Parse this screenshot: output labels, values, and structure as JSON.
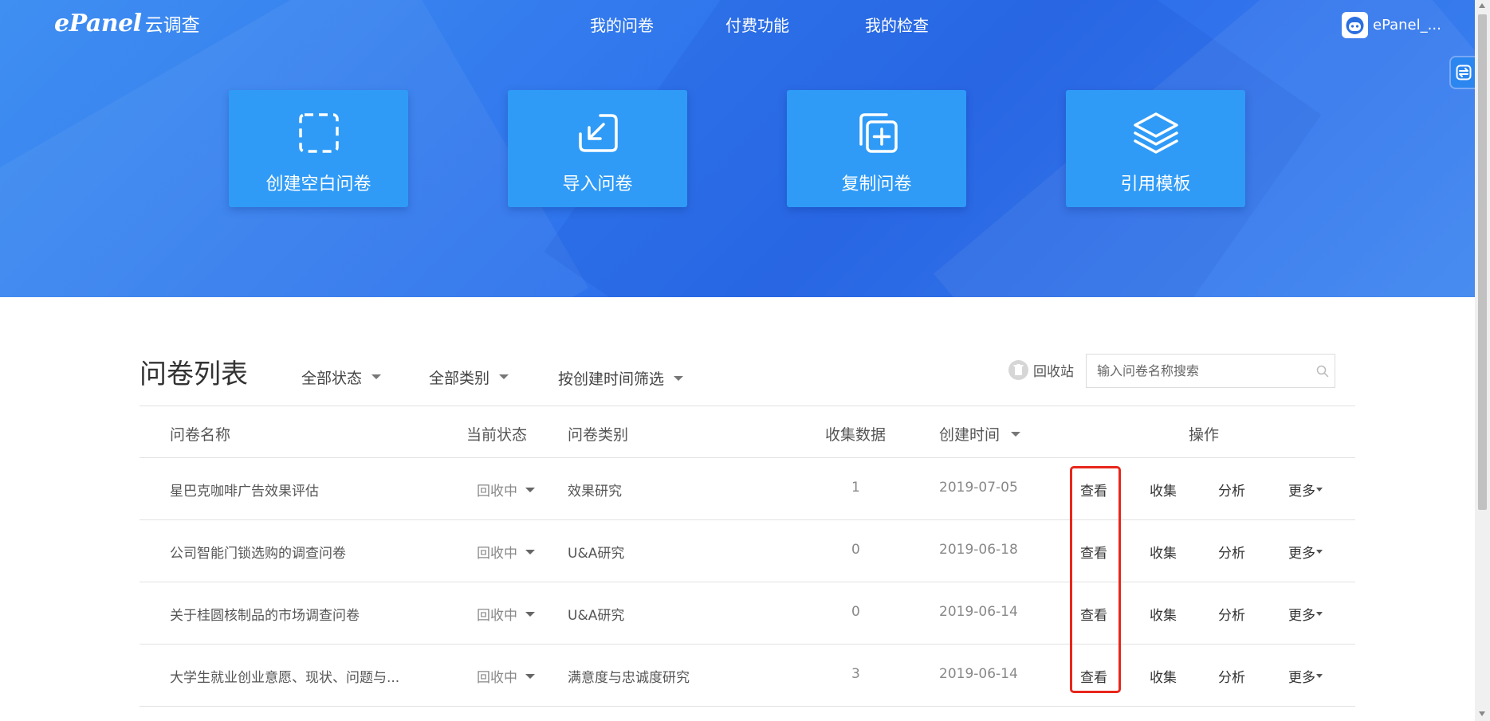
{
  "header": {
    "brand": "ePanel",
    "brand_cn": "云调查",
    "nav": [
      "我的问卷",
      "付费功能",
      "我的检查"
    ],
    "user_name": "ePanel_..."
  },
  "cards": [
    {
      "label": "创建空白问卷",
      "icon": "dashed-square-icon"
    },
    {
      "label": "导入问卷",
      "icon": "import-arrow-icon"
    },
    {
      "label": "复制问卷",
      "icon": "copy-plus-icon"
    },
    {
      "label": "引用模板",
      "icon": "layers-icon"
    }
  ],
  "list": {
    "title": "问卷列表",
    "filters": [
      "全部状态",
      "全部类别",
      "按创建时间筛选"
    ],
    "recycle_label": "回收站",
    "search_placeholder": "输入问卷名称搜索",
    "columns": {
      "name": "问卷名称",
      "status": "当前状态",
      "type": "问卷类别",
      "count": "收集数据",
      "date": "创建时间",
      "actions": "操作"
    },
    "action_labels": {
      "view": "查看",
      "collect": "收集",
      "analyze": "分析",
      "more": "更多"
    },
    "rows": [
      {
        "name": "星巴克咖啡广告效果评估",
        "status": "回收中",
        "type": "效果研究",
        "count": "1",
        "date": "2019-07-05"
      },
      {
        "name": "公司智能门锁选购的调查问卷",
        "status": "回收中",
        "type": "U&A研究",
        "count": "0",
        "date": "2019-06-18"
      },
      {
        "name": "关于桂圆核制品的市场调查问卷",
        "status": "回收中",
        "type": "U&A研究",
        "count": "0",
        "date": "2019-06-14"
      },
      {
        "name": "大学生就业创业意愿、现状、问题与...",
        "status": "回收中",
        "type": "满意度与忠诚度研究",
        "count": "3",
        "date": "2019-06-14"
      }
    ]
  },
  "colors": {
    "hero": "#2f74ec",
    "card": "#2f9bf7",
    "highlight": "#e8261b"
  }
}
